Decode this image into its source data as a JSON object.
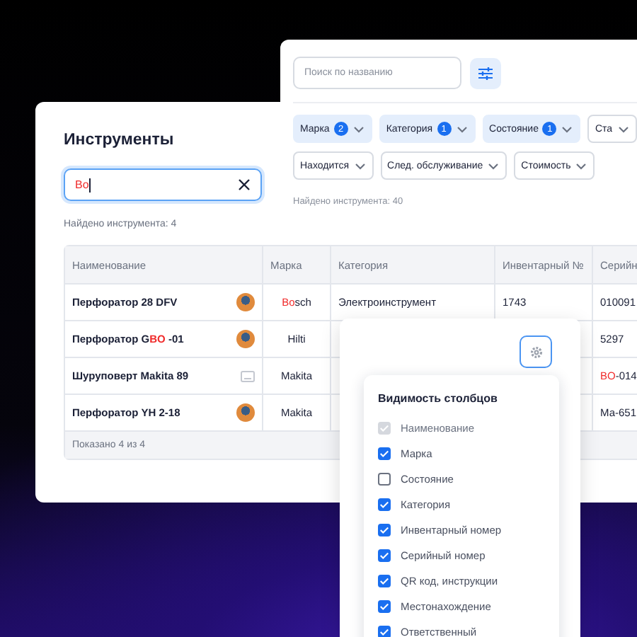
{
  "tools_card": {
    "title": "Инструменты",
    "search": {
      "value": [
        {
          "text": "Bo",
          "highlight": true
        }
      ]
    },
    "found": "Найдено инструмента: 4",
    "table": {
      "columns": [
        "Наименование",
        "Марка",
        "Категория",
        "Инвентарный №",
        "Серийн"
      ],
      "rows": [
        {
          "name": [
            {
              "text": "Перфоратор 28 DFV",
              "highlight": false
            }
          ],
          "thumb": {
            "kind": "photo"
          },
          "brand": [
            {
              "text": "Bo",
              "highlight": true
            },
            {
              "text": "sch",
              "highlight": false
            }
          ],
          "category": "Электроинструмент",
          "inventory": "1743",
          "serial": [
            {
              "text": "010091",
              "highlight": false
            }
          ]
        },
        {
          "name": [
            {
              "text": "Перфоратор G",
              "highlight": false
            },
            {
              "text": "BO",
              "highlight": true
            },
            {
              "text": " -01",
              "highlight": false
            }
          ],
          "thumb": {
            "kind": "photo"
          },
          "brand": [
            {
              "text": "Hilti",
              "highlight": false
            }
          ],
          "serial": [
            {
              "text": "5297",
              "highlight": false
            }
          ]
        },
        {
          "name": [
            {
              "text": "Шуруповерт Makita 89",
              "highlight": false
            }
          ],
          "thumb": {
            "kind": "placeholder"
          },
          "brand": [
            {
              "text": "Makita",
              "highlight": false
            }
          ],
          "serial": [
            {
              "text": "BO",
              "highlight": true
            },
            {
              "text": "-014",
              "highlight": false
            }
          ]
        },
        {
          "name": [
            {
              "text": "Перфоратор YH 2-18",
              "highlight": false
            }
          ],
          "thumb": {
            "kind": "photo"
          },
          "brand": [
            {
              "text": "Makita",
              "highlight": false
            }
          ],
          "serial": [
            {
              "text": "Ма-651",
              "highlight": false
            }
          ]
        }
      ],
      "footer": "Показано 4 из 4"
    }
  },
  "filter_card": {
    "search": {
      "placeholder": "Поиск по названию"
    },
    "filter_rows": [
      [
        {
          "label": "Марка",
          "count": "2",
          "active": true
        },
        {
          "label": "Категория",
          "count": "1",
          "active": true
        },
        {
          "label": "Состояние",
          "count": "1",
          "active": true
        },
        {
          "label": "Ста",
          "active": false
        }
      ],
      [
        {
          "label": "Находится",
          "active": false
        },
        {
          "label": "След. обслуживание",
          "active": false
        },
        {
          "label": "Стоимость",
          "active": false
        }
      ]
    ],
    "found": "Найдено инструмента: 40"
  },
  "columns_popover": {
    "title": "Видимость столбцов",
    "items": [
      {
        "label": "Наименование",
        "checked": true,
        "disabled": true
      },
      {
        "label": "Марка",
        "checked": true,
        "disabled": false
      },
      {
        "label": "Состояние",
        "checked": false,
        "disabled": false
      },
      {
        "label": "Категория",
        "checked": true,
        "disabled": false
      },
      {
        "label": "Инвентарный номер",
        "checked": true,
        "disabled": false
      },
      {
        "label": "Серийный номер",
        "checked": true,
        "disabled": false
      },
      {
        "label": "QR код, инструкции",
        "checked": true,
        "disabled": false
      },
      {
        "label": "Местонахождение",
        "checked": true,
        "disabled": false
      },
      {
        "label": "Ответственный",
        "checked": true,
        "disabled": false
      }
    ]
  }
}
